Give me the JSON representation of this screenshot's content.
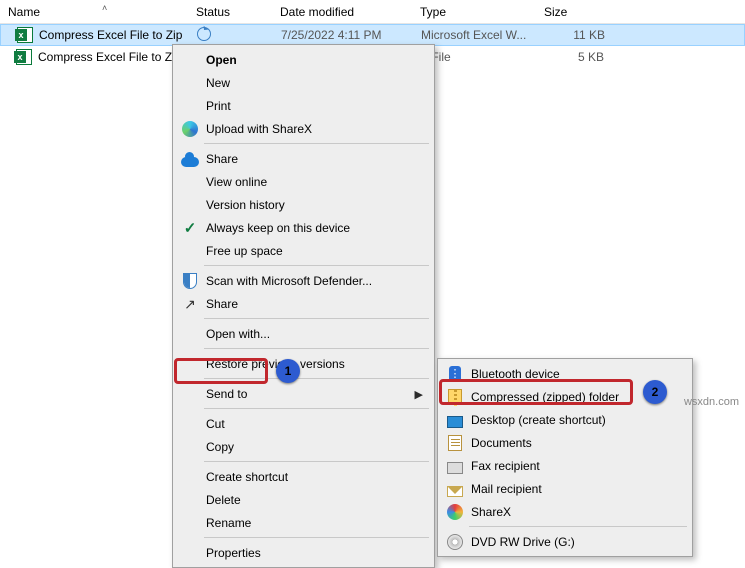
{
  "columns": {
    "name": "Name",
    "status": "Status",
    "date": "Date modified",
    "type": "Type",
    "size": "Size"
  },
  "files": [
    {
      "name": "Compress Excel File to Zip",
      "status_icon": "sync",
      "date": "7/25/2022 4:11 PM",
      "type": "Microsoft Excel W...",
      "size": "11 KB",
      "selected": true
    },
    {
      "name": "Compress Excel File to Zi",
      "status_icon": "",
      "date": "",
      "type": "S File",
      "size": "5 KB",
      "selected": false
    }
  ],
  "context_menu": {
    "open": "Open",
    "new": "New",
    "print": "Print",
    "upload_sharex": "Upload with ShareX",
    "share_cloud": "Share",
    "view_online": "View online",
    "version_history": "Version history",
    "always_keep": "Always keep on this device",
    "free_up": "Free up space",
    "scan_defender": "Scan with Microsoft Defender...",
    "share": "Share",
    "open_with": "Open with...",
    "restore_prev": "Restore previous versions",
    "send_to": "Send to",
    "cut": "Cut",
    "copy": "Copy",
    "create_shortcut": "Create shortcut",
    "delete": "Delete",
    "rename": "Rename",
    "properties": "Properties"
  },
  "send_to_menu": {
    "bluetooth": "Bluetooth device",
    "zip": "Compressed (zipped) folder",
    "desktop": "Desktop (create shortcut)",
    "documents": "Documents",
    "fax": "Fax recipient",
    "mail": "Mail recipient",
    "sharex": "ShareX",
    "dvd": "DVD RW Drive (G:)"
  },
  "annotations": {
    "step1": "1",
    "step2": "2"
  },
  "watermark": "wsxdn.com"
}
